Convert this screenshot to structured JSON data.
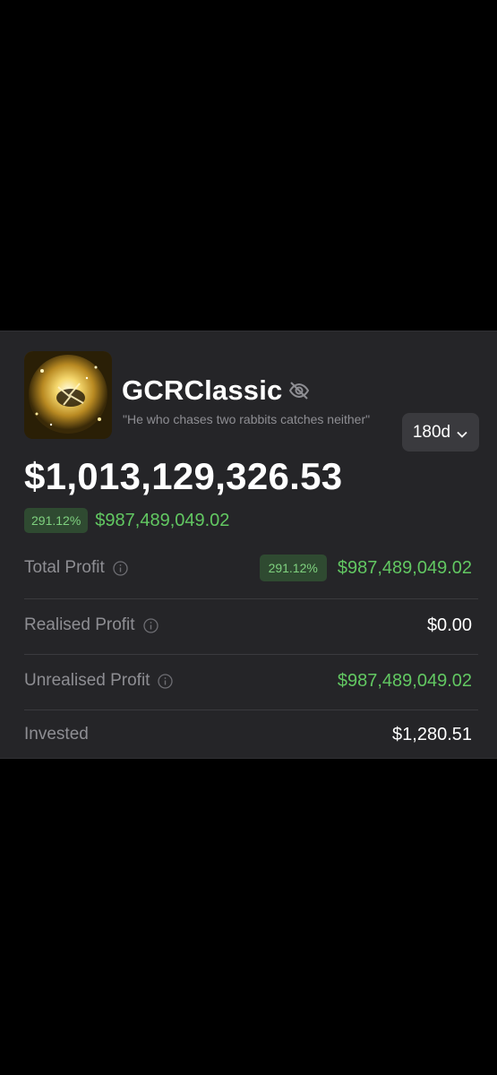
{
  "profile": {
    "name": "GCRClassic",
    "tagline": "\"He who chases two rabbits catches neither\"",
    "avatar_icon": "golden-orb-avatar",
    "visibility_icon": "eye-off-icon"
  },
  "period_selector": {
    "value": "180d",
    "icon": "chevron-down-icon"
  },
  "balance": "$1,013,129,326.53",
  "change": {
    "percent": "291.12%",
    "amount": "$987,489,049.02"
  },
  "stats": [
    {
      "label": "Total Profit",
      "has_info": true,
      "badge": "291.12%",
      "value": "$987,489,049.02",
      "color": "green"
    },
    {
      "label": "Realised Profit",
      "has_info": true,
      "value": "$0.00",
      "color": "white"
    },
    {
      "label": "Unrealised Profit",
      "has_info": true,
      "value": "$987,489,049.02",
      "color": "green"
    },
    {
      "label": "Invested",
      "has_info": false,
      "value": "$1,280.51",
      "color": "white"
    }
  ],
  "colors": {
    "background": "#000000",
    "card": "#252528",
    "positive": "#62c862",
    "badge_bg": "#2f4a31",
    "muted": "#8e8e93"
  }
}
